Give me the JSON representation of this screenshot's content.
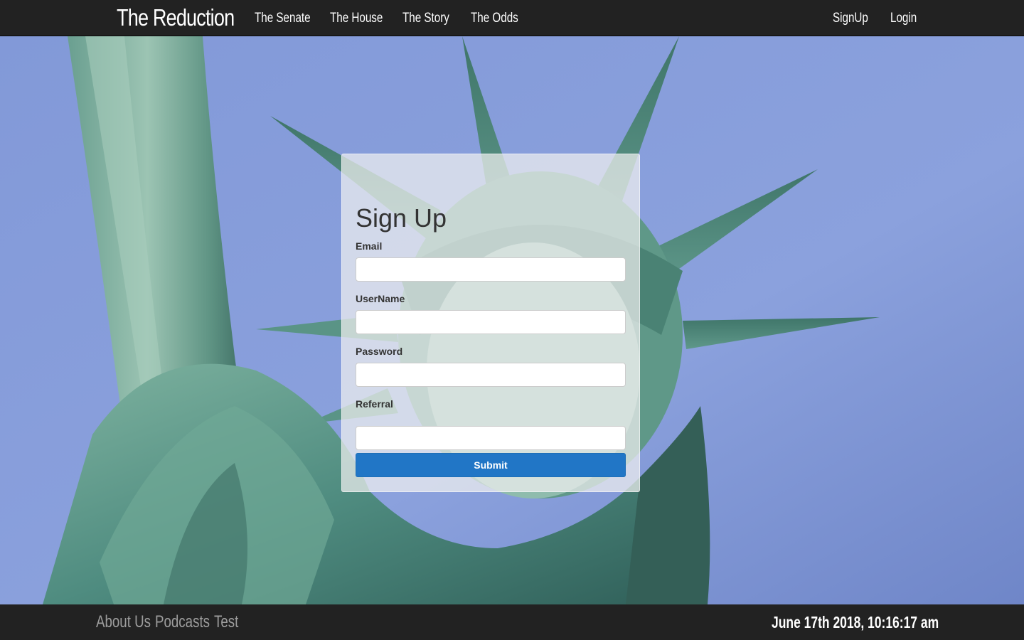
{
  "navbar": {
    "brand": "The Reduction",
    "links": [
      "The Senate",
      "The House",
      "The Story",
      "The Odds"
    ],
    "account_links": [
      "SignUp",
      "Login"
    ]
  },
  "form": {
    "title": "Sign Up",
    "fields": [
      {
        "label": "Email",
        "value": ""
      },
      {
        "label": "UserName",
        "value": ""
      },
      {
        "label": "Password",
        "value": ""
      },
      {
        "label": "Referral",
        "value": ""
      }
    ],
    "submit_label": "Submit"
  },
  "footer": {
    "links": [
      "About Us",
      "Podcasts",
      "Test"
    ],
    "timestamp": "June 17th 2018, 10:16:17 am"
  },
  "colors": {
    "navbar_bg": "#222222",
    "sky": "#8aa0dc",
    "statue_green": "#4f8c80",
    "submit_bg": "#2176c6"
  },
  "background_image": "statue-of-liberty-photo"
}
